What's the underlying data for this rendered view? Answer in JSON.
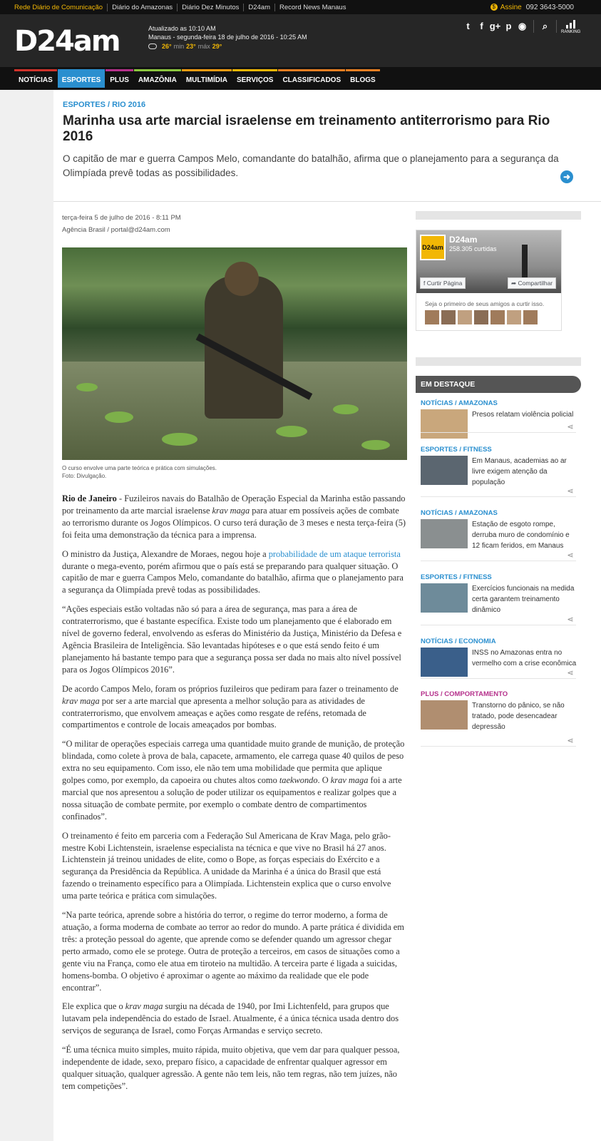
{
  "topbar": {
    "networks": [
      "Rede Diário de Comunicação",
      "Diário do Amazonas",
      "Diário Dez Minutos",
      "D24am",
      "Record News Manaus"
    ],
    "assine_label": "Assine",
    "phone": "092 3643-5000"
  },
  "header": {
    "logo": "D24am",
    "updated": "Atualizado as 10:10 AM",
    "datetime": "Manaus - segunda-feira 18 de julho de 2016 - 10:25 AM",
    "weather": {
      "current": "26°",
      "min_label": "min",
      "min": "23°",
      "max_label": "máx",
      "max": "29°"
    },
    "social_icons": [
      "twitter-icon",
      "facebook-icon",
      "google-plus-icon",
      "pinterest-icon",
      "rss-icon"
    ],
    "ranking_label": "RANKING"
  },
  "nav": {
    "items": [
      {
        "label": "NOTÍCIAS",
        "color": "#d0322b"
      },
      {
        "label": "ESPORTES",
        "color": "#2a8fcf"
      },
      {
        "label": "PLUS",
        "color": "#b5318b"
      },
      {
        "label": "AMAZÔNIA",
        "color": "#8cc63f"
      },
      {
        "label": "MULTIMÍDIA",
        "color": "#f39c12"
      },
      {
        "label": "SERVIÇOS",
        "color": "#f2b705"
      },
      {
        "label": "CLASSIFICADOS",
        "color": "#e67e22"
      },
      {
        "label": "BLOGS",
        "color": "#e67e22"
      }
    ],
    "active": "ESPORTES"
  },
  "article": {
    "category": "ESPORTES / RIO 2016",
    "title": "Marinha usa arte marcial israelense em treinamento antiterrorismo para Rio 2016",
    "lead": "O capitão de mar e guerra Campos Melo, comandante do batalhão, afirma que o planejamento para a segurança da Olimpíada prevê todas as possibilidades.",
    "date": "terça-feira 5 de julho de 2016 - 8:11 PM",
    "source": "Agência Brasil / portal@d24am.com",
    "caption_1": "O curso envolve uma parte teórica e prática com simulações.",
    "caption_2": "Foto: Divulgação.",
    "p1_strong": "Rio de Janeiro",
    "p1_a": " - Fuzileiros navais do Batalhão de Operação Especial da Marinha estão passando por treinamento da arte marcial israelense ",
    "p1_em": "krav maga",
    "p1_b": " para atuar em possíveis ações de combate ao terrorismo durante os Jogos Olímpicos. O curso terá duração de 3 meses e nesta terça-feira (5) foi feita uma demonstração da técnica para a imprensa.",
    "p2_a": "O ministro da Justiça, Alexandre de Moraes, negou hoje a ",
    "p2_link": "probabilidade de um ataque terrorista",
    "p2_b": " durante o mega-evento, porém afirmou que o país está se preparando para qualquer situação. O capitão de mar e guerra Campos Melo, comandante do batalhão, afirma que o planejamento para a segurança da Olimpíada prevê todas as possibilidades.",
    "p3": "“Ações especiais estão voltadas não só para a área de segurança, mas para a área de contraterrorismo, que é bastante específica. Existe todo um planejamento que é elaborado em nível de governo federal, envolvendo as esferas do Ministério da Justiça, Ministério da Defesa e Agência Brasileira de Inteligência. São levantadas hipóteses e o que está sendo feito é um planejamento há bastante tempo para que a segurança possa ser dada no mais alto nível possível para os Jogos Olímpicos 2016”.",
    "p4_a": "De acordo Campos Melo, foram os próprios fuzileiros que pediram para fazer o treinamento de ",
    "p4_em": "krav maga",
    "p4_b": " por ser a arte marcial que apresenta a melhor solução para as atividades de contraterrorismo, que envolvem ameaças e ações como resgate de reféns, retomada de compartimentos e controle de locais ameaçados por bombas.",
    "p5_a": "“O militar de operações especiais carrega uma quantidade muito grande de munição, de proteção blindada, como colete à prova de bala, capacete, armamento, ele carrega quase 40 quilos de peso extra no seu equipamento. Com isso, ele não tem uma mobilidade que permita que aplique golpes como, por exemplo, da capoeira ou chutes altos como ",
    "p5_em1": "taekwondo",
    "p5_b": ". O ",
    "p5_em2": "krav maga",
    "p5_c": " foi a arte marcial que nos apresentou a solução de poder utilizar os equipamentos e realizar golpes que a nossa situação de combate permite, por exemplo o combate dentro de compartimentos confinados”.",
    "p6": "O treinamento é feito em parceria com a Federação Sul Americana de Krav Maga, pelo grão-mestre Kobi Lichtenstein, israelense especialista na técnica e que vive no Brasil há 27 anos. Lichtenstein já treinou unidades de elite, como o Bope, as forças especiais do Exército e a segurança da Presidência da República. A unidade da Marinha é a única do Brasil que está fazendo o treinamento específico para a Olimpíada. Lichtenstein explica que o curso envolve uma parte teórica e prática com simulações.",
    "p7": "“Na parte teórica, aprende sobre a história do terror, o regime do terror moderno, a forma de atuação, a forma moderna de combate ao terror ao redor do mundo. A parte prática é dividida em três: a proteção pessoal do agente, que aprende como se defender quando um agressor chegar perto armado, como ele se protege. Outra de proteção a terceiros, em casos de situações como a gente viu na França, como ele atua em tiroteio na multidão. A terceira parte é ligada a suicidas, homens-bomba. O objetivo é aproximar o agente ao máximo da realidade que ele pode encontrar”.",
    "p8_a": "Ele explica que o ",
    "p8_em": "krav maga",
    "p8_b": " surgiu na década de 1940, por Imi Lichtenfeld, para grupos que lutavam pela independência do estado de Israel. Atualmente, é a única técnica usada dentro dos serviços de segurança de Israel, como Forças Armandas e serviço secreto.",
    "p9": "“É uma técnica muito simples, muito rápida, muito objetiva, que vem dar para qualquer pessoa, independente de idade, sexo, preparo físico, a capacidade de enfrentar qualquer agressor em qualquer situação, qualquer agressão. A gente não tem leis, não tem regras, não tem juízes, não tem competições”."
  },
  "facebook": {
    "page_name": "D24am",
    "logo_text": "D24am",
    "likes": "258.305 curtidas",
    "like_button": "Curtir Página",
    "share_button": "Compartilhar",
    "friends_text": "Seja o primeiro de seus amigos a curtir isso."
  },
  "destaque": {
    "title": "EM DESTAQUE",
    "items": [
      {
        "category": "NOTÍCIAS / AMAZONAS",
        "color": "#2a8fcf",
        "text": "Presos relatam violência policial"
      },
      {
        "category": "ESPORTES / FITNESS",
        "color": "#2a8fcf",
        "text": "Em Manaus, academias ao ar livre exigem atenção da população"
      },
      {
        "category": "NOTÍCIAS / AMAZONAS",
        "color": "#2a8fcf",
        "text": "Estação de esgoto rompe, derruba muro de condomínio e 12 ficam feridos, em Manaus"
      },
      {
        "category": "ESPORTES / FITNESS",
        "color": "#2a8fcf",
        "text": "Exercícios funcionais na medida certa garantem treinamento dinâmico"
      },
      {
        "category": "NOTÍCIAS / ECONOMIA",
        "color": "#2a8fcf",
        "text": "INSS no Amazonas entra no vermelho com a crise econômica"
      },
      {
        "category": "PLUS / COMPORTAMENTO",
        "color": "#b5318b",
        "text": "Transtorno do pânico, se não tratado, pode desencadear depressão"
      }
    ]
  }
}
